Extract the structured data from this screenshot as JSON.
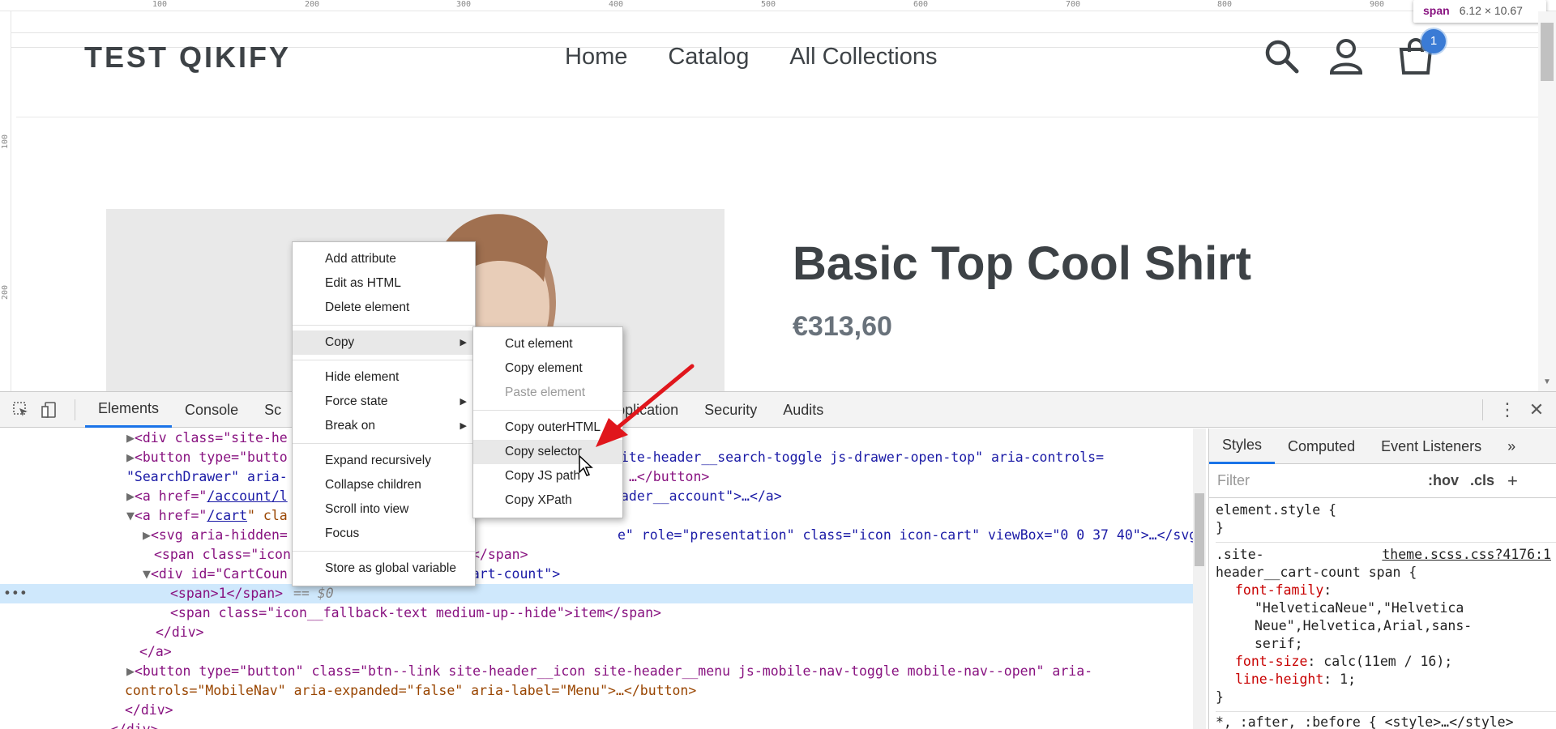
{
  "page": {
    "store_name": "TEST QIKIFY",
    "nav": [
      "Home",
      "Catalog",
      "All Collections"
    ],
    "cart_count": "1",
    "product_title": "Basic Top Cool Shirt",
    "product_price": "€313,60",
    "ruler_top": [
      "100",
      "200",
      "300",
      "400",
      "500",
      "600",
      "700",
      "800",
      "900"
    ],
    "ruler_left": [
      "100",
      "200"
    ]
  },
  "tooltip": {
    "tag": "span",
    "size": "6.12 × 10.67"
  },
  "devtools": {
    "tabs": [
      "Elements",
      "Console",
      "Sc",
      "Application",
      "Security",
      "Audits"
    ],
    "styles_tabs": [
      "Styles",
      "Computed",
      "Event Listeners"
    ],
    "filter_placeholder": "Filter",
    "hov": ":hov",
    "cls": ".cls"
  },
  "context_menu": {
    "items": [
      "Add attribute",
      "Edit as HTML",
      "Delete element",
      "Copy",
      "Hide element",
      "Force state",
      "Break on",
      "Expand recursively",
      "Collapse children",
      "Scroll into view",
      "Focus",
      "Store as global variable"
    ]
  },
  "copy_submenu": {
    "items": [
      "Cut element",
      "Copy element",
      "Paste element",
      "Copy outerHTML",
      "Copy selector",
      "Copy JS path",
      "Copy XPath"
    ]
  },
  "dom_text": {
    "l1a": "<div class=\"site-he",
    "l2a": "<button type=\"butto",
    "l2b": "ite-header__search-toggle js-drawer-open-top\" aria-controls=",
    "l3a": "\"SearchDrawer\" aria-",
    "l3b": "…</button>",
    "l4a": "<a href=\"",
    "l4link": "/account/l",
    "l4b": "ader__account\">…</a>",
    "l5a": "<a href=\"",
    "l5link": "/cart",
    "l5b": "\" cla",
    "l6a": "<svg aria-hidden=",
    "l6b": "e\" role=\"presentation\" class=\"icon icon-cart\" viewBox=\"0 0 37 40\">…</svg>",
    "l7a": "<span class=\"icon",
    "l7b": "</span>",
    "l8a": "<div id=\"CartCoun",
    "l8b": "_cart-count\">",
    "l9": "<span>1</span>",
    "l9eq": "== $0",
    "l10": "<span class=\"icon__fallback-text medium-up--hide\">item</span>",
    "l11": "</div>",
    "l12": "</a>",
    "l13": "<button type=\"button\" class=\"btn--link site-header__icon site-header__menu js-mobile-nav-toggle mobile-nav--open\" aria-",
    "l14": "controls=\"MobileNav\" aria-expanded=\"false\" aria-label=\"Menu\">…</button>",
    "l15": "</div>",
    "l16": "</div>"
  },
  "styles_text": {
    "element_style": "element.style {",
    "close": "}",
    "rule_selector_1": ".site-",
    "rule_source": "theme.scss.css?4176:1",
    "rule_selector_2": "header__cart-count span {",
    "p_font_family": "font-family",
    "v_font_family_1": "\"HelveticaNeue\",\"Helvetica",
    "v_font_family_2": "Neue\",Helvetica,Arial,sans-",
    "v_font_family_3": "serif;",
    "p_font_size": "font-size",
    "v_font_size": "calc(11em / 16);",
    "p_line_height": "line-height",
    "v_line_height": "1;",
    "last_rule": "*, :after, :before {  <style>…</style>"
  },
  "colors": {
    "accent": "#1a73e8",
    "tag": "#881280",
    "attr": "#994500",
    "value": "#1a1aa6",
    "arrow": "#e0161c"
  }
}
